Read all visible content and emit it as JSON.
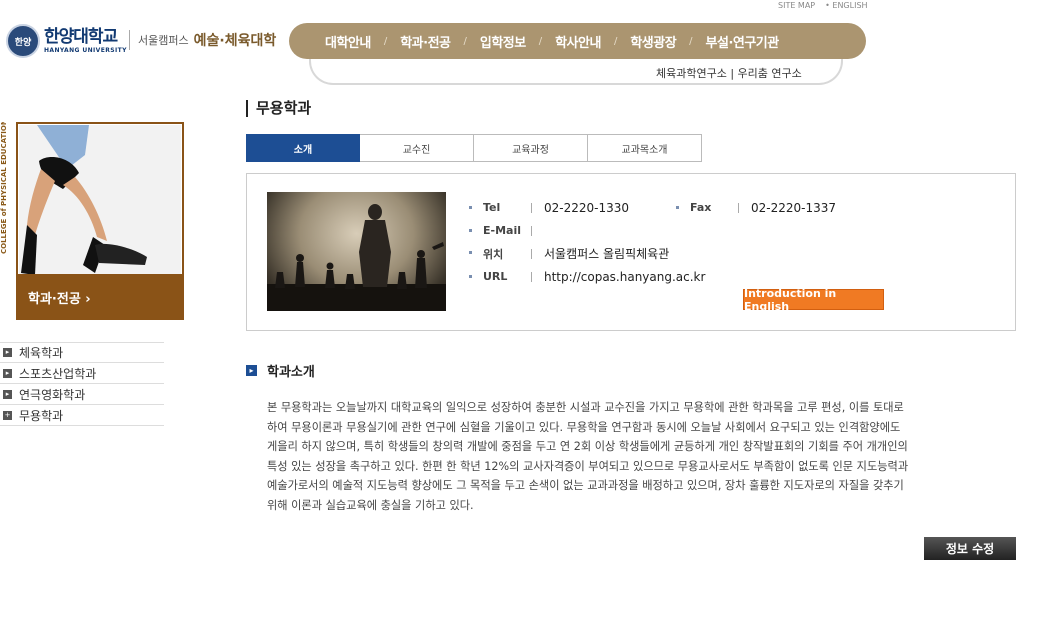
{
  "utility": {
    "sitemap": "SITE MAP",
    "english": "• ENGLISH"
  },
  "logo": {
    "seal": "한양",
    "korean": "한양대학교",
    "english": "HANYANG UNIVERSITY"
  },
  "campus": {
    "sub": "서울캠퍼스",
    "name": "예술·체육대학"
  },
  "gnb": {
    "items": [
      "대학안내",
      "학과·전공",
      "입학정보",
      "학사안내",
      "학생광장",
      "부설·연구기관"
    ],
    "separator": "/"
  },
  "sublinks": "체육과학연구소 | 우리춤 연구소",
  "sidebar": {
    "vertical_text": "COLLEGE of PHYSICAL EDUCATION",
    "promo_label": "학과·전공 ›",
    "menu": [
      "체육학과",
      "스포츠산업학과",
      "연극영화학과",
      "무용학과"
    ]
  },
  "page_title": "무용학과",
  "tabs": [
    "소개",
    "교수진",
    "교육과정",
    "교과목소개"
  ],
  "info": {
    "tel_label": "Tel",
    "tel": "02-2220-1330",
    "fax_label": "Fax",
    "fax": "02-2220-1337",
    "email_label": "E-Mail",
    "email": "",
    "location_label": "위치",
    "location": "서울캠퍼스 올림픽체육관",
    "url_label": "URL",
    "url": "http://copas.hanyang.ac.kr",
    "english_button": "Introduction in English"
  },
  "section": {
    "title": "학과소개",
    "lines": [
      "본 무용학과는 오늘날까지 대학교육의 일익으로 성장하여 충분한 시설과 교수진을 가지고 무용학에 관한 학과목을 고루 편성, 이를 토대로",
      "하여 무용이론과 무용실기에 관한 연구에 심혈을 기울이고 있다. 무용학을 연구함과 동시에 오늘날 사회에서 요구되고 있는 인격함양에도",
      "게을리 하지 않으며, 특히 학생들의 창의력 개발에 중점을 두고 연 2회 이상 학생들에게 균등하게 개인 창작발표회의 기회를 주어 개개인의",
      "특성 있는 성장을 촉구하고 있다. 한편 한 학년 12%의 교사자격증이 부여되고 있으므로 무용교사로서도 부족함이 없도록 인문 지도능력과",
      "예술가로서의 예술적 지도능력 향상에도 그 목적을 두고 손색이 없는 교과과정을 배정하고 있으며, 장차 훌륭한 지도자로의 자질을 갖추기",
      "위해 이론과 실습교육에 충실을 기하고 있다."
    ]
  },
  "edit_button": "정보 수정"
}
